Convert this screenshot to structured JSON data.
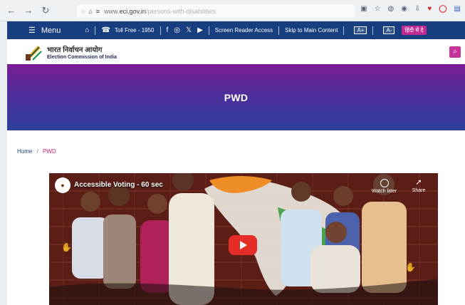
{
  "browser": {
    "url_prefix": "www.",
    "url_domain": "eci.gov.in",
    "url_path": "/persons-with-disabilities",
    "icons": [
      "back-icon",
      "forward-icon",
      "refresh-icon",
      "shield-icon",
      "lock-icon",
      "site-info-icon",
      "reader-icon",
      "star-icon",
      "pocket-icon",
      "account-icon",
      "download-icon",
      "extension-icon",
      "adblock-icon",
      "tab-icon"
    ]
  },
  "top_nav": {
    "menu_label": "Menu",
    "toll_free": "Toll Free - 1950",
    "screen_reader": "Screen Reader Access",
    "skip_main": "Skip to Main Content",
    "font_increase": "A+",
    "font_decrease": "A-",
    "hindi_label": "हिंदी में दे"
  },
  "logo": {
    "hindi": "भारत निर्वाचन आयोग",
    "english": "Election Commission of India"
  },
  "hero": {
    "title": "PWD"
  },
  "breadcrumb": {
    "home": "Home",
    "separator": "/",
    "current": "PWD"
  },
  "video": {
    "title": "Accessible Voting - 60 sec",
    "watch_later": "Watch later",
    "share": "Share"
  },
  "colors": {
    "nav_blue": "#173f80",
    "hero_purple": "#7b1e93",
    "accent_pink": "#c7349c",
    "youtube_red": "#e52d27"
  }
}
